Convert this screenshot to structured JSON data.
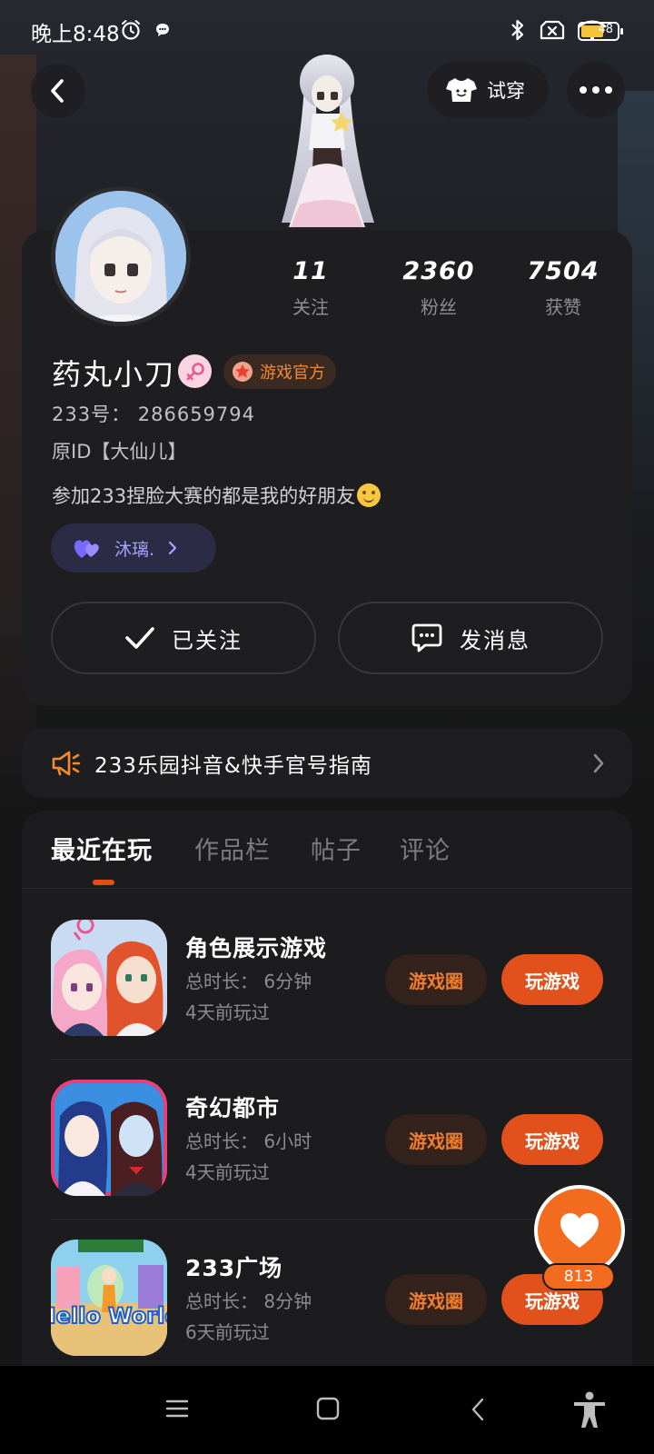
{
  "status_bar": {
    "time": "晚上8:48",
    "battery": "48"
  },
  "header": {
    "tryon_label": "试穿"
  },
  "profile": {
    "stats": [
      {
        "value": "11",
        "label": "关注"
      },
      {
        "value": "2360",
        "label": "粉丝"
      },
      {
        "value": "7504",
        "label": "获赞"
      }
    ],
    "name": "药丸小刀",
    "official_badge": "游戏官方",
    "uid": "233号：  286659794",
    "original_id": "原ID【大仙儿】",
    "bio": "参加233捏脸大赛的都是我的好朋友",
    "friend_tag": "沐璃.",
    "follow_button": "已关注",
    "message_button": "发消息"
  },
  "announcement": {
    "text": "233乐园抖音&快手官号指南"
  },
  "tabs": [
    "最近在玩",
    "作品栏",
    "帖子",
    "评论"
  ],
  "games": [
    {
      "title": "角色展示游戏",
      "duration": "总时长：  6分钟",
      "last_played": "4天前玩过",
      "circle_label": "游戏圈",
      "play_label": "玩游戏"
    },
    {
      "title": "奇幻都市",
      "duration": "总时长：  6小时",
      "last_played": "4天前玩过",
      "circle_label": "游戏圈",
      "play_label": "玩游戏"
    },
    {
      "title": "233广场",
      "duration": "总时长：  8分钟",
      "last_played": "6天前玩过",
      "circle_label": "游戏圈",
      "play_label": "玩游戏"
    }
  ],
  "game_icon_text": {
    "hello_world": "Hello World"
  },
  "float_like": {
    "count": "813"
  },
  "colors": {
    "accent": "#e2501b",
    "official": "#f58a2f",
    "friend": "#a9a3ff"
  }
}
